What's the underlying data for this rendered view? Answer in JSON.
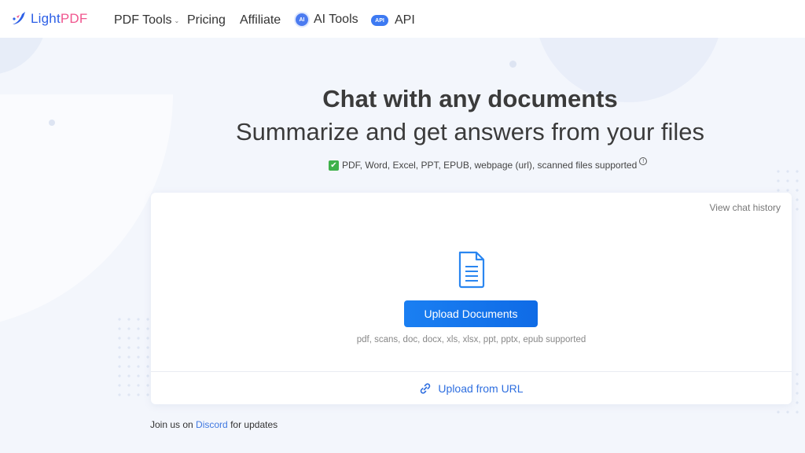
{
  "brand": {
    "name_part1": "Light",
    "name_part2": "PDF"
  },
  "nav": {
    "pdf_tools": "PDF Tools",
    "pricing": "Pricing",
    "affiliate": "Affiliate",
    "ai_tools": "AI Tools",
    "ai_badge": "AI",
    "api": "API",
    "api_badge": "API"
  },
  "hero": {
    "title_line1": "Chat with any documents",
    "title_line2": "Summarize and get answers from your files",
    "supported": "PDF, Word, Excel, PPT, EPUB, webpage (url), scanned files supported"
  },
  "card": {
    "history_link": "View chat history",
    "upload_button": "Upload Documents",
    "formats": "pdf, scans, doc, docx, xls, xlsx, ppt, pptx, epub supported",
    "upload_url": "Upload from URL"
  },
  "footer": {
    "prefix": "Join us on",
    "discord": "Discord",
    "suffix": "for updates"
  },
  "colors": {
    "accent": "#1a7ff2",
    "link": "#2f6fe0",
    "brand_blue": "#2c5fe6",
    "brand_pink": "#f0568e"
  },
  "icons": [
    "logo-icon",
    "chevron-down-icon",
    "ai-icon",
    "api-icon",
    "checkmark-icon",
    "info-icon",
    "document-icon",
    "link-icon"
  ]
}
